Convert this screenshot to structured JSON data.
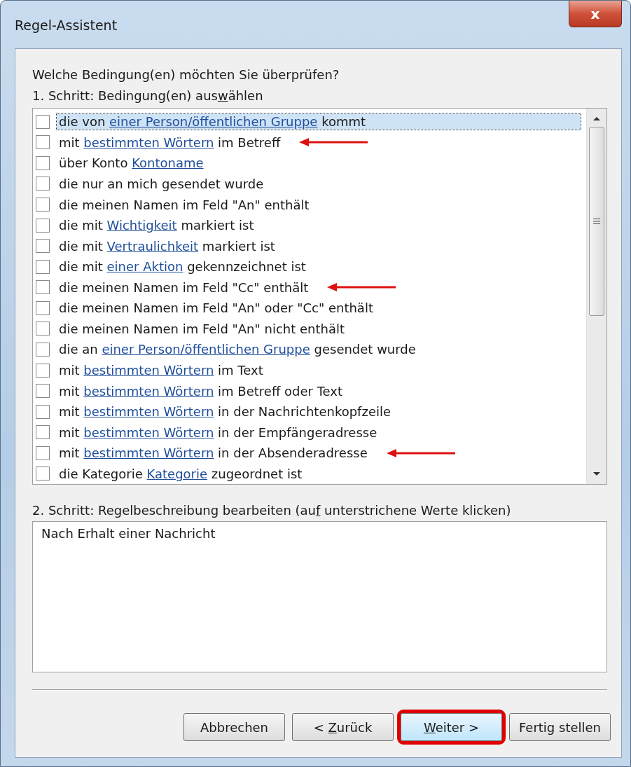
{
  "window": {
    "title": "Regel-Assistent",
    "close_label": "x"
  },
  "question": "Welche Bedingung(en) möchten Sie überprüfen?",
  "step1": [
    {
      "kind": "plain",
      "text": "1. Schritt: Bedingung(en) aus"
    },
    {
      "kind": "accesskey",
      "text": "w"
    },
    {
      "kind": "plain",
      "text": "ählen"
    }
  ],
  "conditions": [
    {
      "checked": false,
      "selected": true,
      "arrow": false,
      "parts": [
        {
          "kind": "plain",
          "text": "die von "
        },
        {
          "kind": "link",
          "text": "einer Person/öffentlichen Gruppe"
        },
        {
          "kind": "plain",
          "text": " kommt"
        }
      ]
    },
    {
      "checked": false,
      "selected": false,
      "arrow": true,
      "parts": [
        {
          "kind": "plain",
          "text": "mit "
        },
        {
          "kind": "link",
          "text": "bestimmten Wörtern"
        },
        {
          "kind": "plain",
          "text": " im Betreff"
        }
      ]
    },
    {
      "checked": false,
      "selected": false,
      "arrow": false,
      "parts": [
        {
          "kind": "plain",
          "text": "über Konto "
        },
        {
          "kind": "link",
          "text": "Kontoname"
        }
      ]
    },
    {
      "checked": false,
      "selected": false,
      "arrow": false,
      "parts": [
        {
          "kind": "plain",
          "text": "die nur an mich gesendet wurde"
        }
      ]
    },
    {
      "checked": false,
      "selected": false,
      "arrow": false,
      "parts": [
        {
          "kind": "plain",
          "text": "die meinen Namen im Feld \"An\" enthält"
        }
      ]
    },
    {
      "checked": false,
      "selected": false,
      "arrow": false,
      "parts": [
        {
          "kind": "plain",
          "text": "die mit "
        },
        {
          "kind": "link",
          "text": "Wichtigkeit"
        },
        {
          "kind": "plain",
          "text": " markiert ist"
        }
      ]
    },
    {
      "checked": false,
      "selected": false,
      "arrow": false,
      "parts": [
        {
          "kind": "plain",
          "text": "die mit "
        },
        {
          "kind": "link",
          "text": "Vertraulichkeit"
        },
        {
          "kind": "plain",
          "text": " markiert ist"
        }
      ]
    },
    {
      "checked": false,
      "selected": false,
      "arrow": false,
      "parts": [
        {
          "kind": "plain",
          "text": "die mit "
        },
        {
          "kind": "link",
          "text": "einer Aktion"
        },
        {
          "kind": "plain",
          "text": " gekennzeichnet ist"
        }
      ]
    },
    {
      "checked": false,
      "selected": false,
      "arrow": true,
      "parts": [
        {
          "kind": "plain",
          "text": "die meinen Namen im Feld \"Cc\" enthält"
        }
      ]
    },
    {
      "checked": false,
      "selected": false,
      "arrow": false,
      "parts": [
        {
          "kind": "plain",
          "text": "die meinen Namen im Feld \"An\" oder \"Cc\" enthält"
        }
      ]
    },
    {
      "checked": false,
      "selected": false,
      "arrow": false,
      "parts": [
        {
          "kind": "plain",
          "text": "die meinen Namen im Feld \"An\" nicht enthält"
        }
      ]
    },
    {
      "checked": false,
      "selected": false,
      "arrow": false,
      "parts": [
        {
          "kind": "plain",
          "text": "die an "
        },
        {
          "kind": "link",
          "text": "einer Person/öffentlichen Gruppe"
        },
        {
          "kind": "plain",
          "text": " gesendet wurde"
        }
      ]
    },
    {
      "checked": false,
      "selected": false,
      "arrow": false,
      "parts": [
        {
          "kind": "plain",
          "text": "mit "
        },
        {
          "kind": "link",
          "text": "bestimmten Wörtern"
        },
        {
          "kind": "plain",
          "text": " im Text"
        }
      ]
    },
    {
      "checked": false,
      "selected": false,
      "arrow": false,
      "parts": [
        {
          "kind": "plain",
          "text": "mit "
        },
        {
          "kind": "link",
          "text": "bestimmten Wörtern"
        },
        {
          "kind": "plain",
          "text": " im Betreff oder Text"
        }
      ]
    },
    {
      "checked": false,
      "selected": false,
      "arrow": false,
      "parts": [
        {
          "kind": "plain",
          "text": "mit "
        },
        {
          "kind": "link",
          "text": "bestimmten Wörtern"
        },
        {
          "kind": "plain",
          "text": " in der Nachrichtenkopfzeile"
        }
      ]
    },
    {
      "checked": false,
      "selected": false,
      "arrow": false,
      "parts": [
        {
          "kind": "plain",
          "text": "mit "
        },
        {
          "kind": "link",
          "text": "bestimmten Wörtern"
        },
        {
          "kind": "plain",
          "text": " in der Empfängeradresse"
        }
      ]
    },
    {
      "checked": false,
      "selected": false,
      "arrow": true,
      "parts": [
        {
          "kind": "plain",
          "text": "mit "
        },
        {
          "kind": "link",
          "text": "bestimmten Wörtern"
        },
        {
          "kind": "plain",
          "text": " in der Absenderadresse"
        }
      ]
    },
    {
      "checked": false,
      "selected": false,
      "arrow": false,
      "parts": [
        {
          "kind": "plain",
          "text": "die Kategorie "
        },
        {
          "kind": "link",
          "text": "Kategorie"
        },
        {
          "kind": "plain",
          "text": " zugeordnet ist"
        }
      ]
    }
  ],
  "step2": [
    {
      "kind": "plain",
      "text": "2. Schritt: Regelbeschreibung bearbeiten (au"
    },
    {
      "kind": "accesskey",
      "text": "f"
    },
    {
      "kind": "plain",
      "text": " unterstrichene Werte klicken)"
    }
  ],
  "description": "Nach Erhalt einer Nachricht",
  "buttons": [
    {
      "highlighted": false,
      "parts": [
        {
          "kind": "plain",
          "text": "Abbrechen"
        }
      ]
    },
    {
      "highlighted": false,
      "parts": [
        {
          "kind": "plain",
          "text": "< "
        },
        {
          "kind": "accesskey",
          "text": "Z"
        },
        {
          "kind": "plain",
          "text": "urück"
        }
      ]
    },
    {
      "highlighted": true,
      "parts": [
        {
          "kind": "accesskey",
          "text": "W"
        },
        {
          "kind": "plain",
          "text": "eiter >"
        }
      ]
    },
    {
      "highlighted": false,
      "parts": [
        {
          "kind": "plain",
          "text": "Fertig stellen"
        }
      ]
    }
  ]
}
